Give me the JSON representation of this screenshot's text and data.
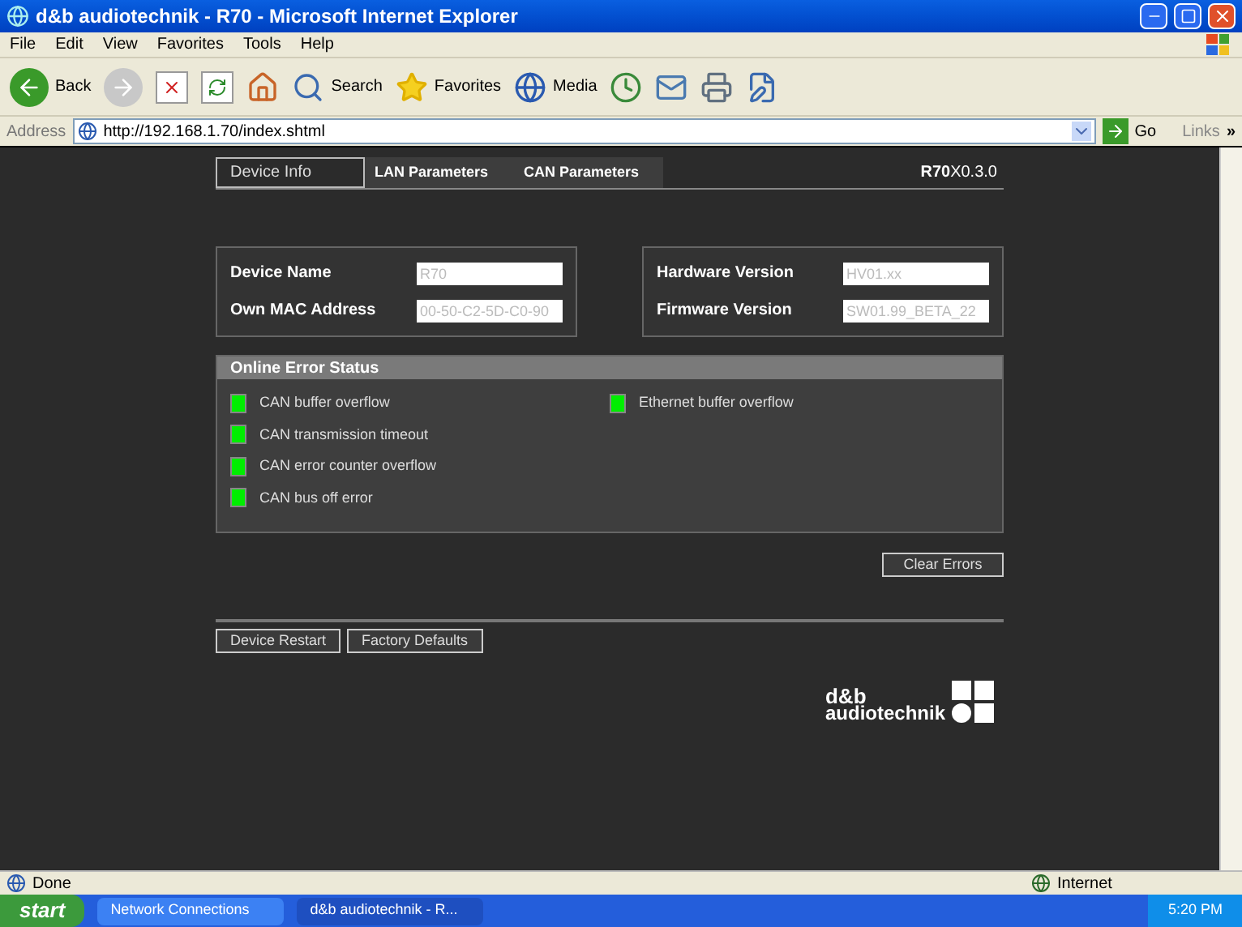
{
  "window": {
    "title": "d&b audiotechnik - R70 - Microsoft Internet Explorer"
  },
  "menu": [
    "File",
    "Edit",
    "View",
    "Favorites",
    "Tools",
    "Help"
  ],
  "toolbar": [
    {
      "kind": "back",
      "label": "Back"
    },
    {
      "kind": "forward"
    },
    {
      "kind": "stop"
    },
    {
      "kind": "refresh"
    },
    {
      "kind": "home"
    },
    {
      "kind": "search",
      "label": "Search"
    },
    {
      "kind": "favorites",
      "label": "Favorites"
    },
    {
      "kind": "media",
      "label": "Media"
    },
    {
      "kind": "history"
    },
    {
      "kind": "mail"
    },
    {
      "kind": "print"
    },
    {
      "kind": "edit"
    }
  ],
  "address": {
    "label": "Address",
    "url": "http://192.168.1.70/index.shtml",
    "go": "Go",
    "links": "Links",
    "more": "»"
  },
  "tabs": [
    {
      "label": "Device Info",
      "selected": true
    },
    {
      "label": "LAN Parameters",
      "selected": false
    },
    {
      "label": "CAN Parameters",
      "selected": false
    }
  ],
  "version": "**R70**X0.3.0",
  "device_panel": [
    {
      "label": "Device Name",
      "value": "R70"
    },
    {
      "label": "Own MAC Address",
      "value": "00-50-C2-5D-C0-90"
    }
  ],
  "version_panel": [
    {
      "label": "Hardware Version",
      "value": "HV01.xx"
    },
    {
      "label": "Firmware Version",
      "value": "SW01.99_BETA_22"
    }
  ],
  "error_status": {
    "title": "Online Error Status",
    "columns": [
      [
        {
          "label": "CAN buffer overflow",
          "color": "#00ee00"
        },
        {
          "label": "CAN transmission timeout",
          "color": "#00ee00"
        },
        {
          "label": "CAN error counter overflow",
          "color": "#00ee00"
        },
        {
          "label": "CAN bus off error",
          "color": "#00ee00"
        }
      ],
      [
        {
          "label": "Ethernet buffer overflow",
          "color": "#00ee00"
        }
      ]
    ]
  },
  "clear_button": "Clear Errors",
  "bottom_buttons": [
    "Device Restart",
    "Factory Defaults"
  ],
  "logo": {
    "line1": "d&b",
    "line2": "audiotechnik"
  },
  "status_bar": {
    "text": "Done",
    "zone": "Internet"
  },
  "taskbar": {
    "start": "start",
    "tasks": [
      {
        "label": "Network Connections",
        "selected": false
      },
      {
        "label": "d&b audiotechnik - R...",
        "selected": true
      }
    ],
    "clock": "5:20 PM"
  }
}
